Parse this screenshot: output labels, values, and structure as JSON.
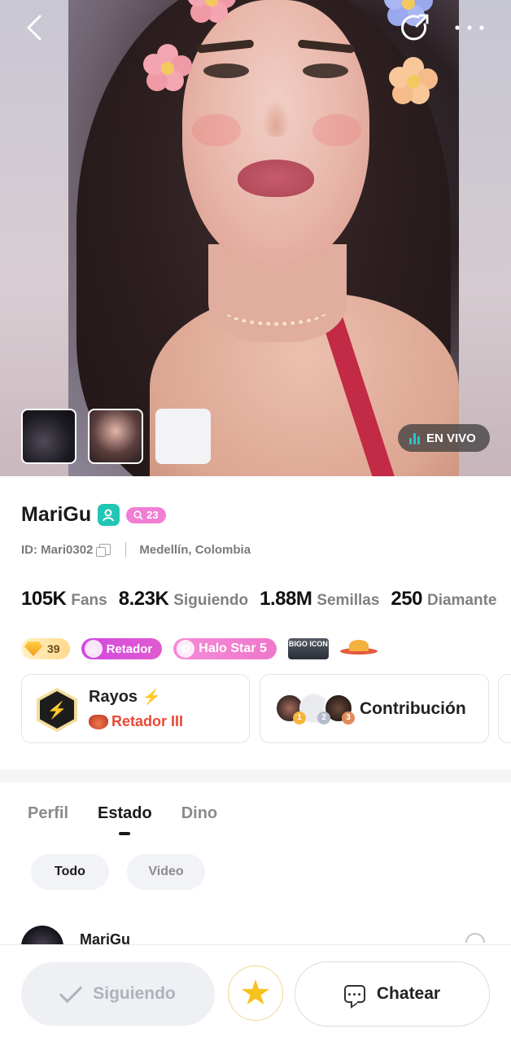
{
  "hero": {
    "live_label": "EN VIVO",
    "thumbnails": [
      "video-thumbnail",
      "photo-thumbnail",
      "empty-thumbnail"
    ]
  },
  "profile": {
    "name": "MariGu",
    "level": "23",
    "id_text": "ID: Mari0302",
    "location": "Medellín, Colombia",
    "stats": [
      {
        "value": "105K",
        "label": "Fans"
      },
      {
        "value": "8.23K",
        "label": "Siguiendo"
      },
      {
        "value": "1.88M",
        "label": "Semillas"
      },
      {
        "value": "250",
        "label": "Diamante"
      }
    ],
    "badges": {
      "diamond_count": "39",
      "retador": "Retador",
      "halo": "Halo Star 5",
      "bigo_icon": "BIGO ICON"
    }
  },
  "cards": {
    "rayos_title": "Rayos",
    "rayos_rank": "Retador III",
    "contribution_label": "Contribución",
    "medals": [
      "1",
      "2",
      "3"
    ]
  },
  "tabs": [
    {
      "label": "Perfil",
      "active": false
    },
    {
      "label": "Estado",
      "active": true
    },
    {
      "label": "Dino",
      "active": false
    }
  ],
  "filters": [
    {
      "label": "Todo",
      "active": true
    },
    {
      "label": "Video",
      "active": false
    }
  ],
  "post": {
    "author": "MariGu"
  },
  "actions": {
    "follow_label": "Siguiendo",
    "chat_label": "Chatear"
  },
  "colors": {
    "verified": "#20c7b4",
    "level_pill": "#f07fd4",
    "live_bars": "#27c4c7",
    "rank_text": "#e74936",
    "star": "#f8c21c"
  }
}
